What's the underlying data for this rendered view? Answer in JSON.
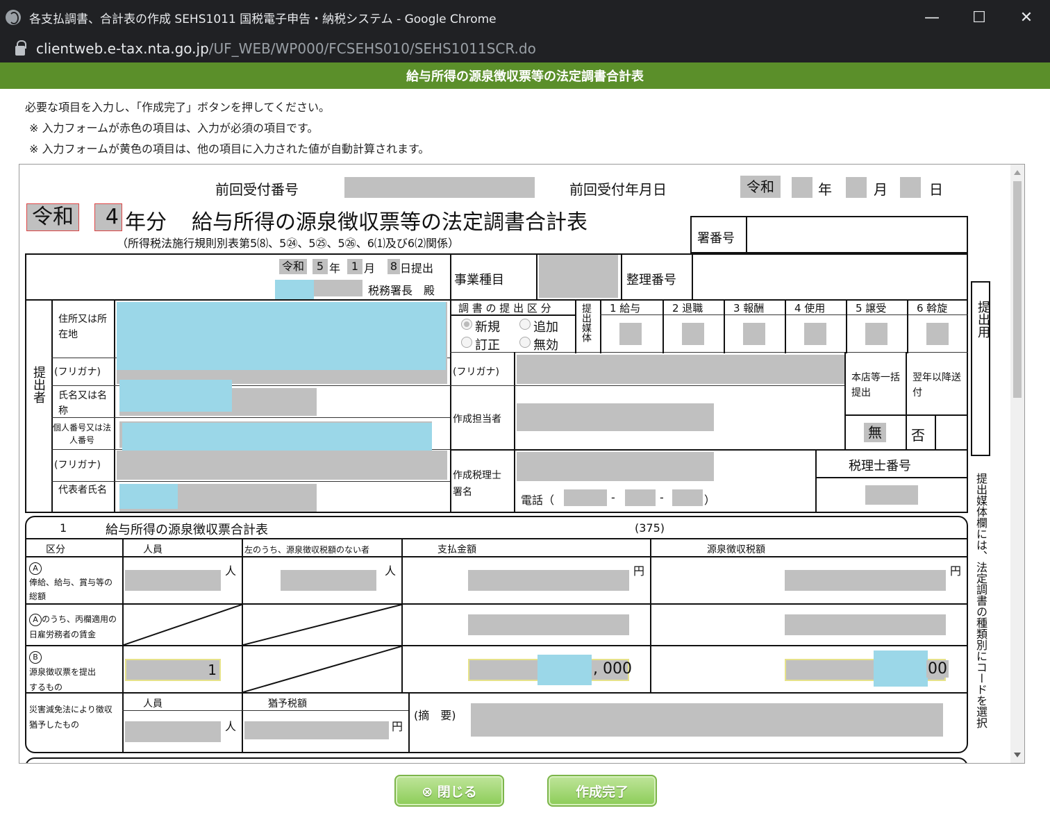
{
  "window": {
    "title": "各支払調書、合計表の作成 SEHS1011 国税電子申告・納税システム - Google Chrome",
    "url_host": "clientweb.e-tax.nta.go.jp",
    "url_path": "/UF_WEB/WP000/FCSEHS010/SEHS1011SCR.do",
    "minimize": "—",
    "maximize": "☐",
    "close": "✕"
  },
  "header": {
    "title": "給与所得の源泉徴収票等の法定調書合計表"
  },
  "instructions": {
    "line1": "必要な項目を入力し、「作成完了」ボタンを押してください。",
    "line2": "※ 入力フォームが赤色の項目は、入力が必須の項目です。",
    "line3": "※ 入力フォームが黄色の項目は、他の項目に入力された値が自動計算されます。"
  },
  "form": {
    "prev_receipt_no": "前回受付番号",
    "prev_receipt_date": "前回受付年月日",
    "era_small": "令和",
    "year_u": "年",
    "month_u": "月",
    "day_u": "日",
    "era_big": "令和",
    "year_val": "4",
    "title_suffix": "年分",
    "main_title": "給与所得の源泉徴収票等の法定調書合計表",
    "law_ref": "（所得税法施行規則別表第5⑻、5㉔、5㉕、5㉖、6⑴及び6⑵関係）",
    "tax_office_no": "署番号",
    "submit_era": "令和",
    "submit_year": "5",
    "submit_month": "1",
    "submit_day": "8",
    "submit_suffix": "日提出",
    "tax_office_chief": "税務署長　殿",
    "business_type": "事業種目",
    "reference_no": "整理番号",
    "submitter": "提出者",
    "address": "住所又は所在地",
    "furigana": "(フリガナ)",
    "name": "氏名又は名称",
    "individual_no": "個人番号又は法人番号",
    "representative": "代表者氏名",
    "submission_type": "調 書 の 提 出 区 分",
    "new": "新規",
    "add": "追加",
    "correct": "訂正",
    "invalid": "無効",
    "media": "提出媒体",
    "media_cols": [
      "1 給与",
      "2 退職",
      "3 報酬",
      "4 使用",
      "5 譲受",
      "6 斡旋"
    ],
    "for_submission": "提出用",
    "hq_batch": "本店等一括提出",
    "next_year_send": "翌年以降送付",
    "no": "無",
    "deny": "否",
    "preparer": "作成担当者",
    "tax_accountant": "作成税理士署名",
    "phone": "電話（",
    "phone_close": "）",
    "dash": "-",
    "accountant_no": "税理士番号",
    "side_note": "提出媒体欄には、法定調書の種類別にコードを選択"
  },
  "section1": {
    "no": "1",
    "title": "給与所得の源泉徴収票合計表",
    "code": "(375)",
    "col_kubun": "区分",
    "col_people": "人員",
    "col_no_tax": "左のうち、源泉徴収税額のない者",
    "col_payment": "支払金額",
    "col_withheld": "源泉徴収税額",
    "unit_person": "人",
    "unit_yen": "円",
    "row_a_mark": "A",
    "row_a": "俸給、給与、賞与等の総額",
    "row_a2": "のうち、丙欄適用の日雇労務者の賃金",
    "row_b_mark": "B",
    "row_b": "源泉徴収票を提出するもの",
    "row_b_people": "1",
    "row_b_payment_tail": ", 000",
    "row_b_withheld_tail": "00",
    "disaster": "災害減免法により徴収猶予したもの",
    "deferred_tax": "猶予税額",
    "remarks": "(摘　要)"
  },
  "buttons": {
    "close": "⊗ 閉じる",
    "complete": "作成完了"
  }
}
